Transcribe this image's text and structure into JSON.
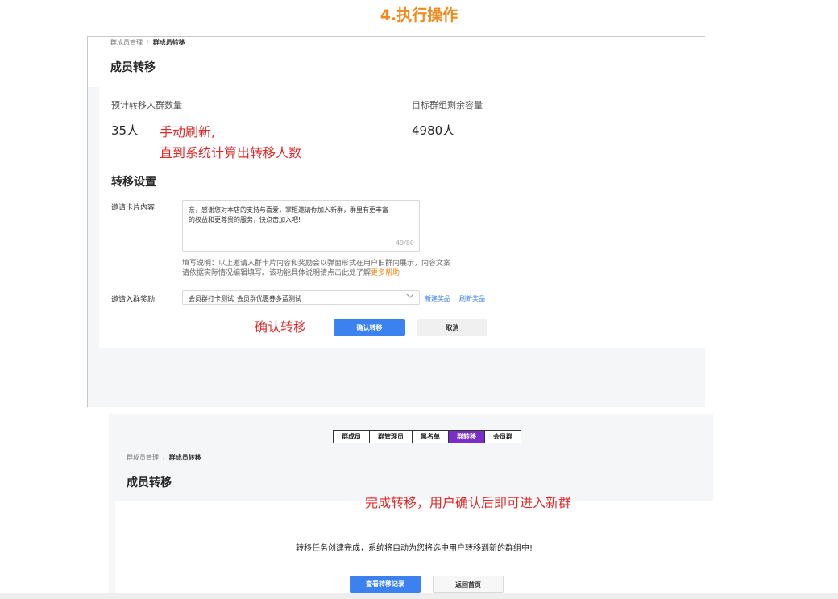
{
  "step_title": "4.执行操作",
  "panel1": {
    "breadcrumb": {
      "parent": "群成员管理",
      "separator": "/",
      "current": "群成员转移"
    },
    "page_title": "成员转移",
    "stats": {
      "expected_label": "预计转移人群数量",
      "expected_value": "35人",
      "remaining_label": "目标群组剩余容量",
      "remaining_value": "4980人"
    },
    "annotation_refresh_line1": "手动刷新,",
    "annotation_refresh_line2": "直到系统计算出转移人数",
    "settings": {
      "section_title": "转移设置",
      "invite_card_label": "邀请卡片内容",
      "invite_card_line1": "亲，感谢您对本店的支持与喜爱，掌柜邀请你加入新群，群里有更丰富",
      "invite_card_line2": "的权益和更尊贵的服务，快点击加入吧!",
      "counter": "49/80",
      "hint_line1": "填写说明：以上邀请入群卡片内容和奖励会以弹窗形式在用户旧群内展示，内容文案",
      "hint_line2_prefix": "请依据实际情况编辑填写。该功能具体说明请点击此处了解",
      "hint_link": "更多帮助",
      "reward_label": "邀请入群奖励",
      "reward_value": "会员群打卡测试_会员群优惠券多蓝测试",
      "new_reward_link": "新建奖品",
      "refresh_reward_link": "刷新奖品"
    },
    "annotation_confirm": "确认转移",
    "confirm_button": "确认转移",
    "cancel_button": "取消"
  },
  "panel2": {
    "tabs": [
      {
        "label": "群成员",
        "active": false
      },
      {
        "label": "群管理员",
        "active": false
      },
      {
        "label": "黑名单",
        "active": false
      },
      {
        "label": "群转移",
        "active": true
      },
      {
        "label": "会员群",
        "active": false
      }
    ],
    "breadcrumb": {
      "parent": "群成员管理",
      "separator": "/",
      "current": "群成员转移"
    },
    "page_title": "成员转移",
    "annotation_done": "完成转移，用户确认后即可进入新群",
    "success_message": "转移任务创建完成，系统将自动为您将选中用户转移到新的群组中!",
    "view_records_button": "查看转移记录",
    "back_home_button": "返回首页"
  },
  "colors": {
    "accent_orange": "#f08a1d",
    "annotation_red": "#e02a2a",
    "primary_blue": "#3b82f0",
    "active_tab_purple": "#7a2ec9"
  },
  "icons": {
    "select_arrow": "chevron-down-icon"
  }
}
